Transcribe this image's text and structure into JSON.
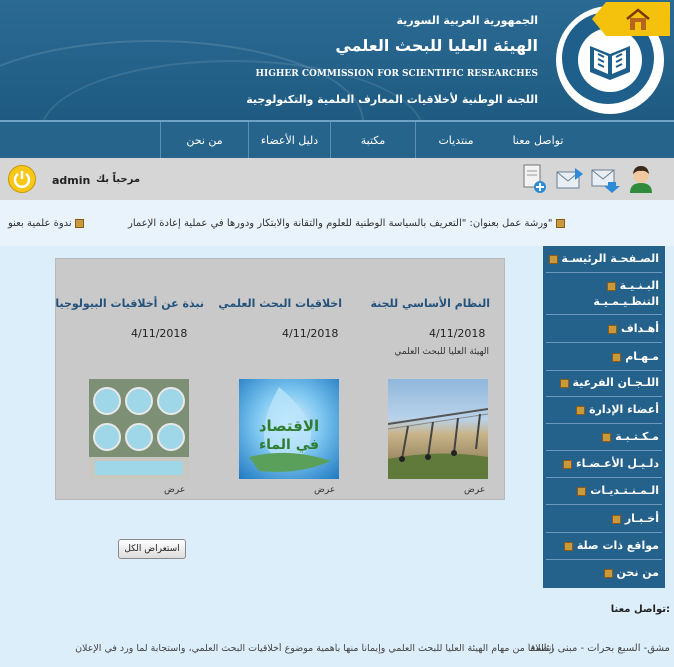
{
  "header": {
    "line1": "الجمهورية العربية السورية",
    "line2": "الهيئة العليا للبحث العلمي",
    "line3": "HIGHER COMMISSION FOR SCIENTIFIC RESEARCHES",
    "line4": "اللجنة الوطنية لأخلاقيات المعارف العلمية والتكنولوجية",
    "logo_text_ar": "الهيئة العليا للبحث العلمي",
    "logo_text_en": "Higher Commission for Scientific Research"
  },
  "nav": {
    "items": [
      "تواصل معنا",
      "منتديات",
      "مكتبة",
      "دليل الأعضاء",
      "من نحن"
    ],
    "home_icon": "home-icon"
  },
  "userbar": {
    "welcome": "مرحباً بك",
    "username": "admin",
    "icons": [
      "user-icon",
      "mail-in-icon",
      "mail-out-icon",
      "new-doc-icon",
      "power-icon"
    ]
  },
  "ticker": {
    "item1": "ورشة عمل بعنوان: \"التعريف بالسياسة الوطنية للعلوم والتقانة والابتكار ودورها في عملية إعادة الإعمار\"",
    "item2": "ندوة علمية بعنو"
  },
  "news": [
    {
      "title": "النظام الأساسي للجنة",
      "date": "4/11/2018",
      "sub": "الهيئة العليا للبحث العلمي",
      "action": "عرض",
      "image": "irrigation-photo"
    },
    {
      "title": "اخلاقيات البحث العلمي",
      "date": "4/11/2018",
      "sub": "",
      "action": "عرض",
      "image": "water-economy-photo"
    },
    {
      "title": "نبذة عن أخلاقيات البيولوجيا",
      "date": "4/11/2018",
      "sub": "",
      "action": "عرض",
      "image": "water-treatment-photo"
    }
  ],
  "show_all": "استعراض الكل",
  "sidebar": {
    "items": [
      "الصـفحـة الرئيسـة",
      "البـنـيـة التنظـيـمـيـة",
      "أهـداف",
      "مـهـام",
      "اللـجـان الفرعية",
      "أعضاء الإدارة",
      "مـكـتـبـة",
      "دلـيـل الأعـضـاء",
      "الـمـنـتـديـات",
      "أخـبـار",
      "مواقع ذات صلة",
      "من نحن"
    ]
  },
  "contact": {
    "title": "تواصل معنا:",
    "line1": "دمشق- السبع بحرات - مبنى رئاسة"
  },
  "paragraph": {
    "line1": "انطلاقاً من مهام الهيئة العليا للبحث العلمي وإيماناً منها بأهمية موضوع أخلاقيات البحث العلمي، واستجابة لما ورد في الإعلان"
  },
  "colors": {
    "header_blue": "#24628a",
    "nav_blue": "#26648c",
    "accent_yellow": "#f4c20d",
    "sidebar_blue": "#24618b",
    "content_bg": "#ddeefb"
  }
}
